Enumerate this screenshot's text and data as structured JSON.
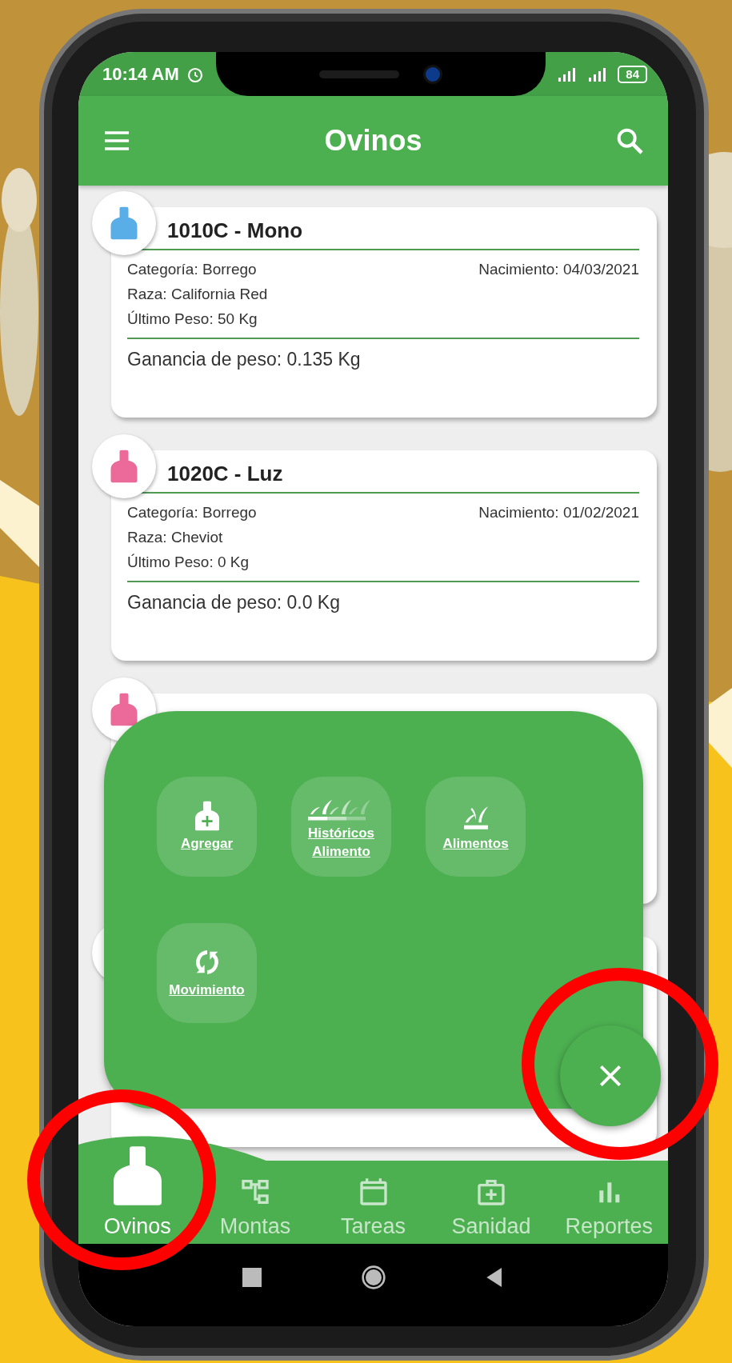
{
  "status_bar": {
    "time": "10:14 AM",
    "battery": "84"
  },
  "app_bar": {
    "title": "Ovinos"
  },
  "cards": [
    {
      "title": "1010C - Mono",
      "color": "#5aaee8",
      "category": "Categoría: Borrego",
      "birth": "Nacimiento: 04/03/2021",
      "breed": "Raza: California Red",
      "last_weight": "Último Peso: 50 Kg",
      "gain": "Ganancia de peso: 0.135 Kg"
    },
    {
      "title": "1020C - Luz",
      "color": "#ec6a9a",
      "category": "Categoría: Borrego",
      "birth": "Nacimiento: 01/02/2021",
      "breed": "Raza: Cheviot",
      "last_weight": "Último Peso: 0 Kg",
      "gain": "Ganancia de peso: 0.0 Kg"
    }
  ],
  "covered_card": {
    "color": "#ec6a9a"
  },
  "menu": {
    "items": [
      {
        "kind": "add",
        "label": "Agregar"
      },
      {
        "kind": "history",
        "label": "Históricos Alimento"
      },
      {
        "kind": "food",
        "label": "Alimentos"
      },
      {
        "kind": "move",
        "label": "Movimiento"
      }
    ]
  },
  "bottom_nav": [
    {
      "kind": "sheep",
      "label": "Ovinos",
      "selected": true
    },
    {
      "kind": "tree",
      "label": "Montas",
      "selected": false
    },
    {
      "kind": "calendar",
      "label": "Tareas",
      "selected": false
    },
    {
      "kind": "health",
      "label": "Sanidad",
      "selected": false
    },
    {
      "kind": "chart",
      "label": "Reportes",
      "selected": false
    }
  ]
}
